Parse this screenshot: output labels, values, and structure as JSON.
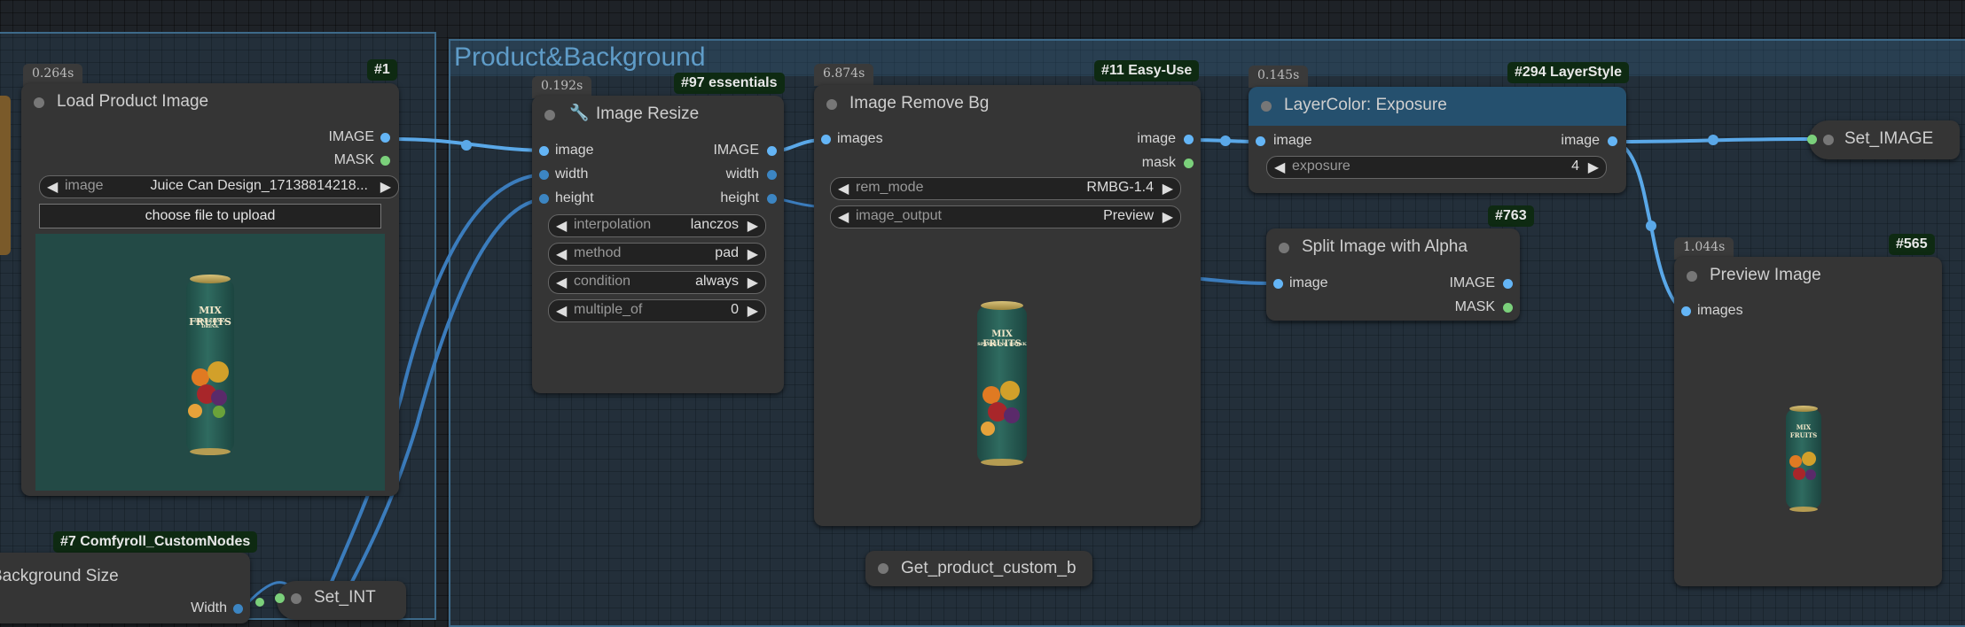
{
  "group": {
    "title": "Product&Background"
  },
  "nodes": {
    "load": {
      "timing": "0.264s",
      "badge": "#1",
      "title": "Load Product Image",
      "outputs": [
        "IMAGE",
        "MASK"
      ],
      "image_widget": {
        "label": "image",
        "value": "Juice Can Design_17138814218..."
      },
      "upload_button": "choose file to upload"
    },
    "resize": {
      "timing": "0.192s",
      "badge": "#97 essentials",
      "title": "Image Resize",
      "inputs": [
        "image",
        "width",
        "height"
      ],
      "outputs": [
        "IMAGE",
        "width",
        "height"
      ],
      "widgets": [
        {
          "label": "interpolation",
          "value": "lanczos"
        },
        {
          "label": "method",
          "value": "pad"
        },
        {
          "label": "condition",
          "value": "always"
        },
        {
          "label": "multiple_of",
          "value": "0"
        }
      ]
    },
    "removebg": {
      "timing": "6.874s",
      "badge": "#11 Easy-Use",
      "title": "Image Remove Bg",
      "inputs": [
        "images"
      ],
      "outputs": [
        "image",
        "mask"
      ],
      "widgets": [
        {
          "label": "rem_mode",
          "value": "RMBG-1.4"
        },
        {
          "label": "image_output",
          "value": "Preview"
        }
      ]
    },
    "exposure": {
      "timing": "0.145s",
      "badge": "#294 LayerStyle",
      "title": "LayerColor: Exposure",
      "inputs": [
        "image"
      ],
      "outputs": [
        "image"
      ],
      "widgets": [
        {
          "label": "exposure",
          "value": "4"
        }
      ]
    },
    "split": {
      "badge": "#763",
      "title": "Split Image with Alpha",
      "inputs": [
        "image"
      ],
      "outputs": [
        "IMAGE",
        "MASK"
      ]
    },
    "preview": {
      "timing": "1.044s",
      "badge": "#565",
      "title": "Preview Image",
      "inputs": [
        "images"
      ]
    },
    "set_image": {
      "title": "Set_IMAGE"
    },
    "get_product": {
      "title": "Get_product_custom_b"
    },
    "bgsize": {
      "badge": "#7 Comfyroll_CustomNodes",
      "title": "Background Size",
      "partial_label": "Width"
    },
    "set_int": {
      "title": "Set_INT"
    }
  },
  "thumbnail": {
    "brand_line1": "MIX FRUITS",
    "brand_line2": "SPARKLING DRINK"
  },
  "colors": {
    "canvas": "#1e2227",
    "node": "#353535",
    "accent_node_header": "#25506e",
    "image_slot": "#64b5f6",
    "mask_slot": "#7bd07b",
    "badge_bg": "#0e2a12"
  }
}
